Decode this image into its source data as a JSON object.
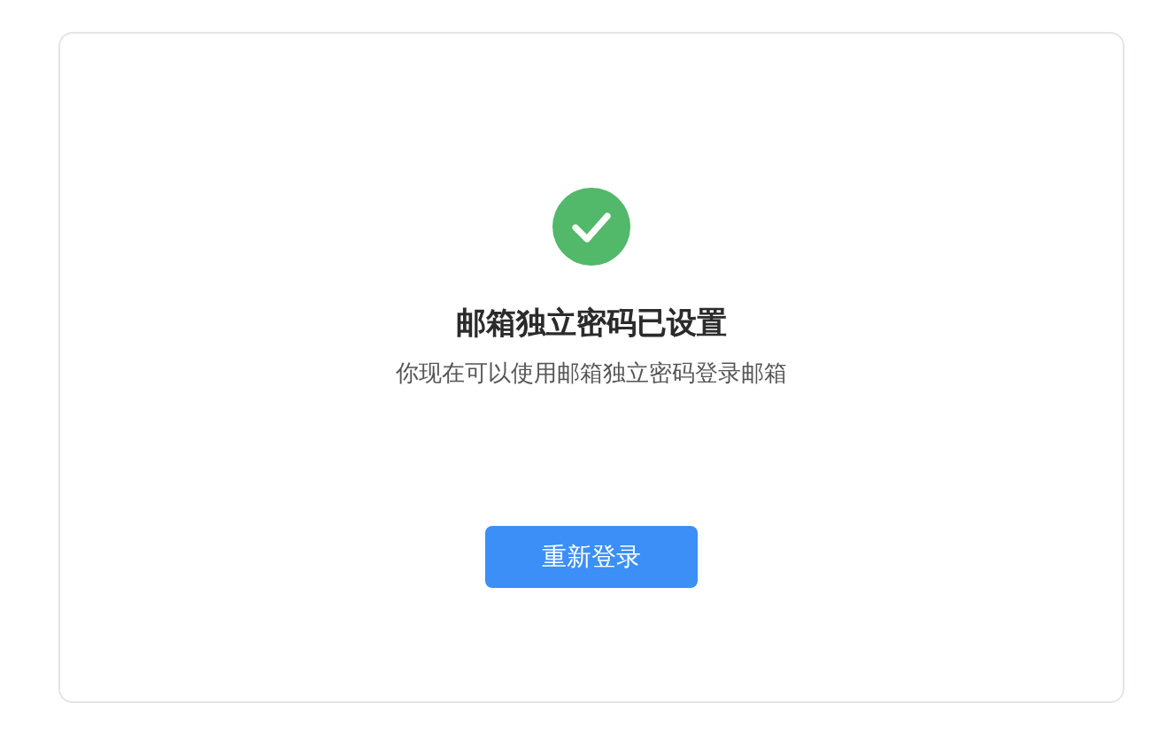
{
  "status": {
    "kind": "success"
  },
  "title": "邮箱独立密码已设置",
  "message": "你现在可以使用邮箱独立密码登录邮箱",
  "button": {
    "label": "重新登录"
  }
}
